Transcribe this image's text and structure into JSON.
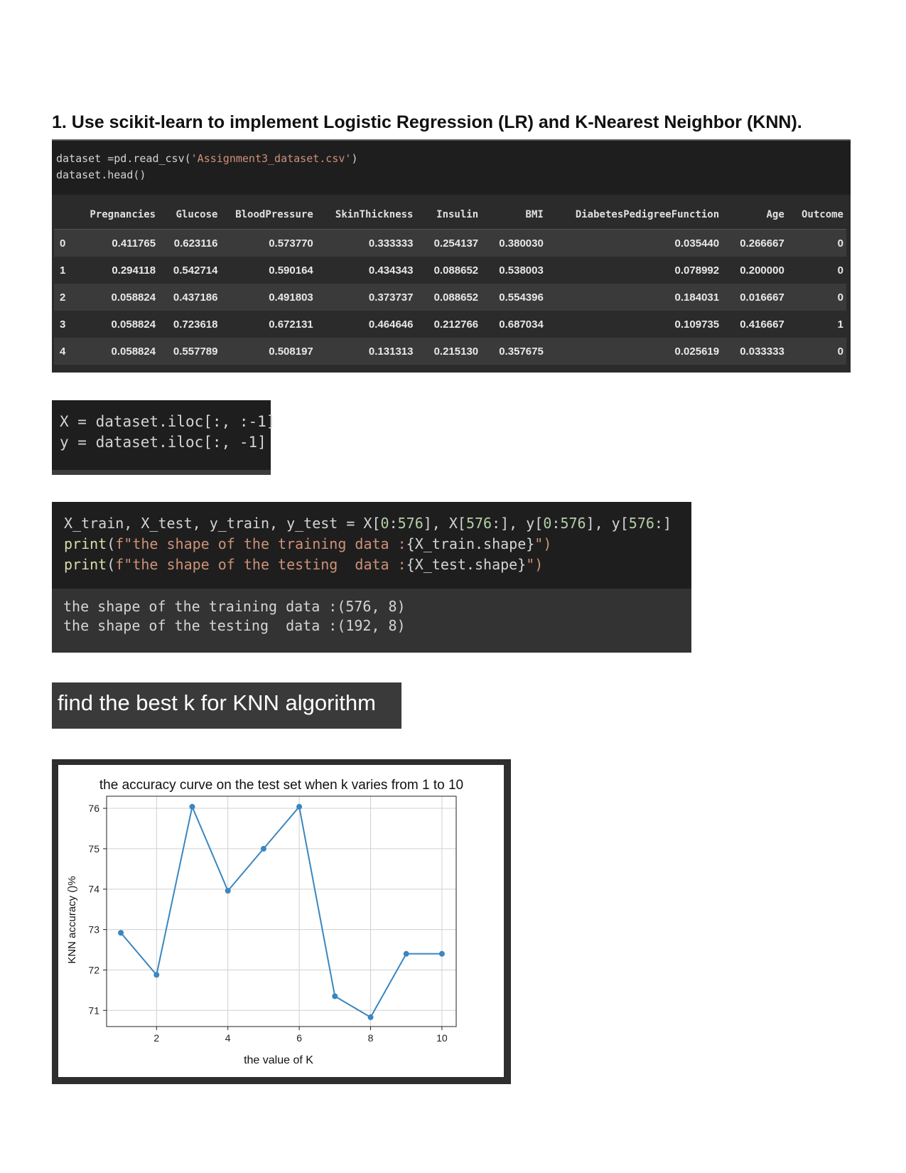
{
  "heading": "1. Use scikit-learn to implement Logistic Regression (LR) and K-Nearest Neighbor (KNN).",
  "cell1": {
    "code_line1_a": "dataset =pd.read_csv(",
    "code_line1_str": "'Assignment3_dataset.csv'",
    "code_line1_b": ")",
    "code_line2": "dataset.head()",
    "table": {
      "columns": [
        "",
        "Pregnancies",
        "Glucose",
        "BloodPressure",
        "SkinThickness",
        "Insulin",
        "BMI",
        "DiabetesPedigreeFunction",
        "Age",
        "Outcome"
      ],
      "rows": [
        [
          "0",
          "0.411765",
          "0.623116",
          "0.573770",
          "0.333333",
          "0.254137",
          "0.380030",
          "0.035440",
          "0.266667",
          "0"
        ],
        [
          "1",
          "0.294118",
          "0.542714",
          "0.590164",
          "0.434343",
          "0.088652",
          "0.538003",
          "0.078992",
          "0.200000",
          "0"
        ],
        [
          "2",
          "0.058824",
          "0.437186",
          "0.491803",
          "0.373737",
          "0.088652",
          "0.554396",
          "0.184031",
          "0.016667",
          "0"
        ],
        [
          "3",
          "0.058824",
          "0.723618",
          "0.672131",
          "0.464646",
          "0.212766",
          "0.687034",
          "0.109735",
          "0.416667",
          "1"
        ],
        [
          "4",
          "0.058824",
          "0.557789",
          "0.508197",
          "0.131313",
          "0.215130",
          "0.357675",
          "0.025619",
          "0.033333",
          "0"
        ]
      ]
    }
  },
  "cell2": {
    "line1": "X = dataset.iloc[:, :-1]",
    "line2": "y = dataset.iloc[:, -1]"
  },
  "cell3": {
    "line1_a": "X_train, X_test, y_train, y_test = X[",
    "line1_n1": "0",
    "line1_b": ":",
    "line1_n2": "576",
    "line1_c": "], X[",
    "line1_n3": "576",
    "line1_d": ":], y[",
    "line1_n4": "0",
    "line1_e": ":",
    "line1_n5": "576",
    "line1_f": "], y[",
    "line1_n6": "576",
    "line1_g": ":]",
    "line2_kw": "print",
    "line2_a": "(",
    "line2_str": "f\"the shape of the training data :",
    "line2_expr": "{X_train.shape}",
    "line2_end": "\")",
    "line3_kw": "print",
    "line3_a": "(",
    "line3_str": "f\"the shape of the testing  data :",
    "line3_expr": "{X_test.shape}",
    "line3_end": "\")",
    "output": [
      "the shape of the training data :(576, 8)",
      "the shape of the testing  data :(192, 8)"
    ]
  },
  "markdown": "find the best k for KNN algorithm",
  "chart_data": {
    "type": "line",
    "title": "the accuracy curve on the test set when k varies from 1 to 10",
    "xlabel": "the value of K",
    "ylabel": "KNN accuracy ()%",
    "x": [
      1,
      2,
      3,
      4,
      5,
      6,
      7,
      8,
      9,
      10
    ],
    "y": [
      72.92,
      71.88,
      76.04,
      73.96,
      75.0,
      76.04,
      71.35,
      70.83,
      72.4,
      72.4
    ],
    "xticks": [
      2,
      4,
      6,
      8,
      10
    ],
    "yticks": [
      71,
      72,
      73,
      74,
      75,
      76
    ],
    "grid": true,
    "color": "#3a86c0"
  }
}
